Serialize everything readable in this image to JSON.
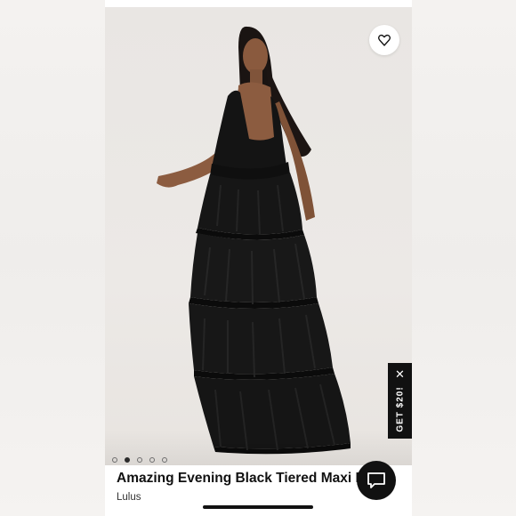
{
  "product": {
    "title": "Amazing Evening Black Tiered Maxi Dress",
    "brand": "Lulus"
  },
  "carousel": {
    "slides": 5,
    "active_index": 1
  },
  "promo": {
    "label": "GET $20!",
    "close": "✕"
  },
  "icons": {
    "favorite": "heart-outline-icon",
    "chat": "chat-bubble-icon"
  },
  "colors": {
    "dress": "#141414",
    "promo_bg": "#111111",
    "chat_bg": "#111111"
  }
}
